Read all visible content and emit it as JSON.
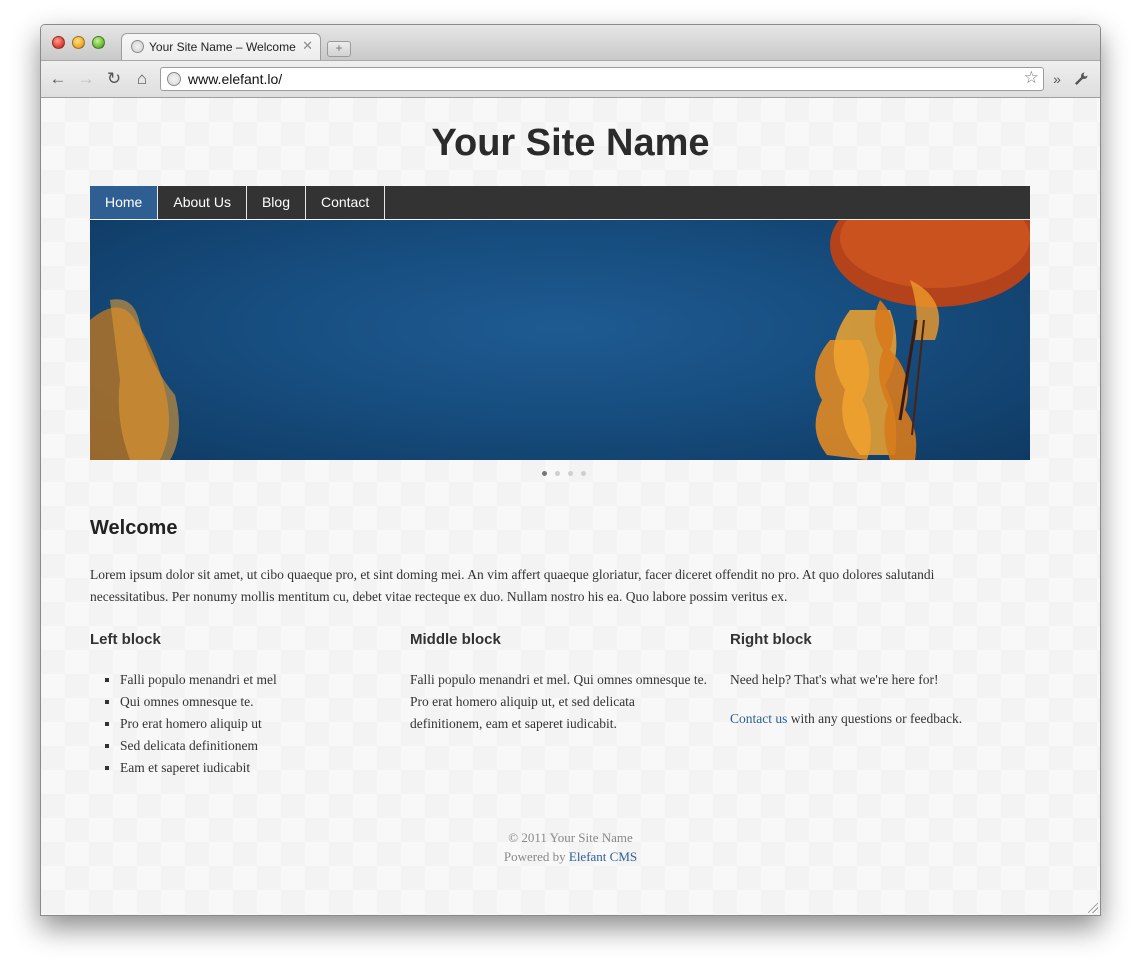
{
  "browser": {
    "tab_title": "Your Site Name – Welcome",
    "tab_close": "✕",
    "new_tab": "+",
    "url": "www.elefant.lo/",
    "icons": {
      "back": "←",
      "forward": "→",
      "reload": "↻",
      "home": "⌂",
      "star": "☆",
      "more": "»",
      "wrench": "🔧"
    }
  },
  "site": {
    "title": "Your Site Name",
    "nav": [
      {
        "label": "Home",
        "active": true
      },
      {
        "label": "About Us",
        "active": false
      },
      {
        "label": "Blog",
        "active": false
      },
      {
        "label": "Contact",
        "active": false
      }
    ],
    "slider": {
      "dots": 4,
      "active_index": 0
    },
    "welcome_heading": "Welcome",
    "intro": "Lorem ipsum dolor sit amet, ut cibo quaeque pro, et sint doming mei. An vim affert quaeque gloriatur, facer diceret offendit no pro. At quo dolores salutandi necessitatibus. Per nonumy mollis mentitum cu, debet vitae recteque ex duo. Nullam nostro his ea. Quo labore possim veritus ex.",
    "left_block": {
      "title": "Left block",
      "items": [
        "Falli populo menandri et mel",
        "Qui omnes omnesque te.",
        "Pro erat homero aliquip ut",
        "Sed delicata definitionem",
        "Eam et saperet iudicabit"
      ]
    },
    "middle_block": {
      "title": "Middle block",
      "text": "Falli populo menandri et mel. Qui omnes omnesque te. Pro erat homero aliquip ut, et sed delicata definitionem, eam et saperet iudicabit."
    },
    "right_block": {
      "title": "Right block",
      "help_text": "Need help? That's what we're here for!",
      "contact_link": "Contact us",
      "contact_suffix": " with any questions or feedback."
    },
    "footer": {
      "copyright": "© 2011 Your Site Name",
      "powered_prefix": "Powered by ",
      "powered_link": "Elefant CMS"
    },
    "colors": {
      "nav_bg": "#333333",
      "nav_active": "#2f5e93",
      "link": "#2c5f95",
      "hero_blue": "#174e80"
    }
  }
}
